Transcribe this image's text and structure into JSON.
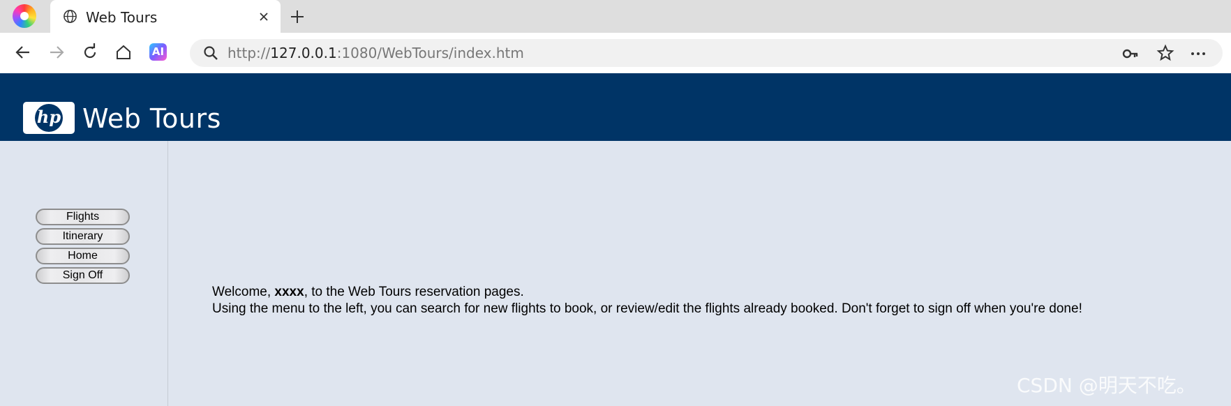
{
  "browser": {
    "tab": {
      "title": "Web Tours"
    },
    "address": {
      "prefix": "http://",
      "host": "127.0.0.1",
      "suffix": ":1080/WebTours/index.htm"
    },
    "ai_label": "AI"
  },
  "page": {
    "logo_text": "hp",
    "site_title": "Web Tours",
    "menu": [
      {
        "label": "Flights"
      },
      {
        "label": "Itinerary"
      },
      {
        "label": "Home"
      },
      {
        "label": "Sign Off"
      }
    ],
    "welcome": {
      "prefix": "Welcome, ",
      "user": "xxxx",
      "suffix": ", to the Web Tours reservation pages.",
      "line2": "Using the menu to the left, you can search for new flights to book, or review/edit the flights already booked. Don't forget to sign off when you're done!"
    }
  },
  "watermark": "CSDN @明天不吃。",
  "colors": {
    "header_bg": "#003466",
    "page_bg": "#dfe5ef"
  }
}
